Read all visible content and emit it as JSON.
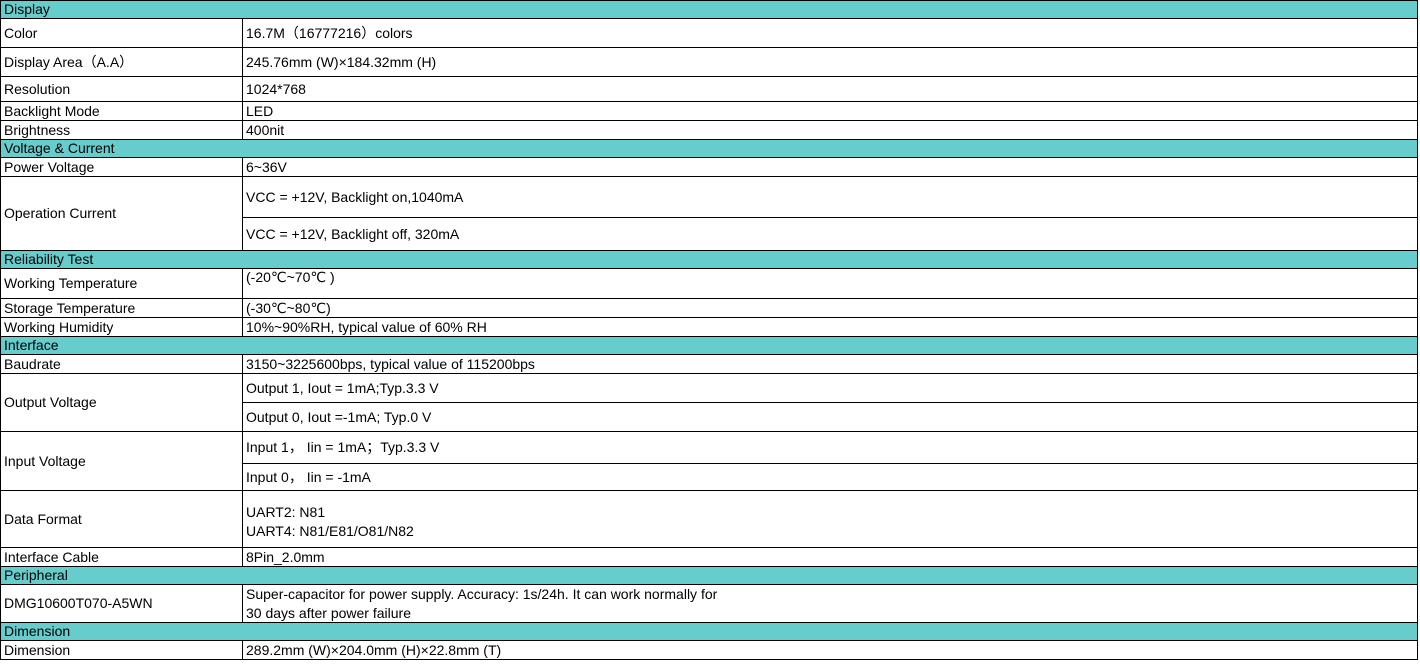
{
  "sections": {
    "display": "Display",
    "voltage_current": "Voltage & Current",
    "reliability": "Reliability Test",
    "interface": "Interface",
    "peripheral": "Peripheral",
    "dimension": "Dimension"
  },
  "display": {
    "color": {
      "label": "Color",
      "value": "16.7M（16777216）colors"
    },
    "area": {
      "label": "Display Area（A.A）",
      "value": "245.76mm (W)×184.32mm (H)"
    },
    "resolution": {
      "label": "Resolution",
      "value": "1024*768"
    },
    "backlight": {
      "label": "Backlight Mode",
      "value": "LED"
    },
    "brightness": {
      "label": "Brightness",
      "value": "400nit"
    }
  },
  "voltage_current": {
    "power_voltage": {
      "label": "Power Voltage",
      "value": "6~36V"
    },
    "operation_current": {
      "label": "Operation Current",
      "value_on": "VCC = +12V, Backlight on,1040mA",
      "value_off": "VCC = +12V, Backlight off, 320mA"
    }
  },
  "reliability": {
    "working_temp": {
      "label": "Working Temperature",
      "value": "(-20℃~70℃ )"
    },
    "storage_temp": {
      "label": "Storage Temperature",
      "value": "(-30℃~80℃)"
    },
    "humidity": {
      "label": "Working Humidity",
      "value": "10%~90%RH, typical value of 60% RH"
    }
  },
  "interface": {
    "baudrate": {
      "label": "Baudrate",
      "value": "3150~3225600bps, typical value of 115200bps"
    },
    "output_voltage": {
      "label": "Output Voltage",
      "value_1": "Output 1, Iout = 1mA;Typ.3.3 V",
      "value_0": "Output 0, Iout =-1mA; Typ.0 V"
    },
    "input_voltage": {
      "label": "Input Voltage",
      "value_1": "Input 1， Iin = 1mA；Typ.3.3 V",
      "value_0": "Input 0， Iin = -1mA"
    },
    "data_format": {
      "label": "Data Format",
      "line_1": "UART2: N81",
      "line_2": "UART4: N81/E81/O81/N82"
    },
    "cable": {
      "label": "Interface Cable",
      "value": "8Pin_2.0mm"
    }
  },
  "peripheral": {
    "rtc": {
      "label": "DMG10600T070-A5WN",
      "line_1": "Super-capacitor for power supply. Accuracy: 1s/24h. It can work normally for",
      "line_2": "30 days after power failure"
    }
  },
  "dimension": {
    "size": {
      "label": "Dimension",
      "value": "289.2mm (W)×204.0mm (H)×22.8mm (T)"
    }
  }
}
